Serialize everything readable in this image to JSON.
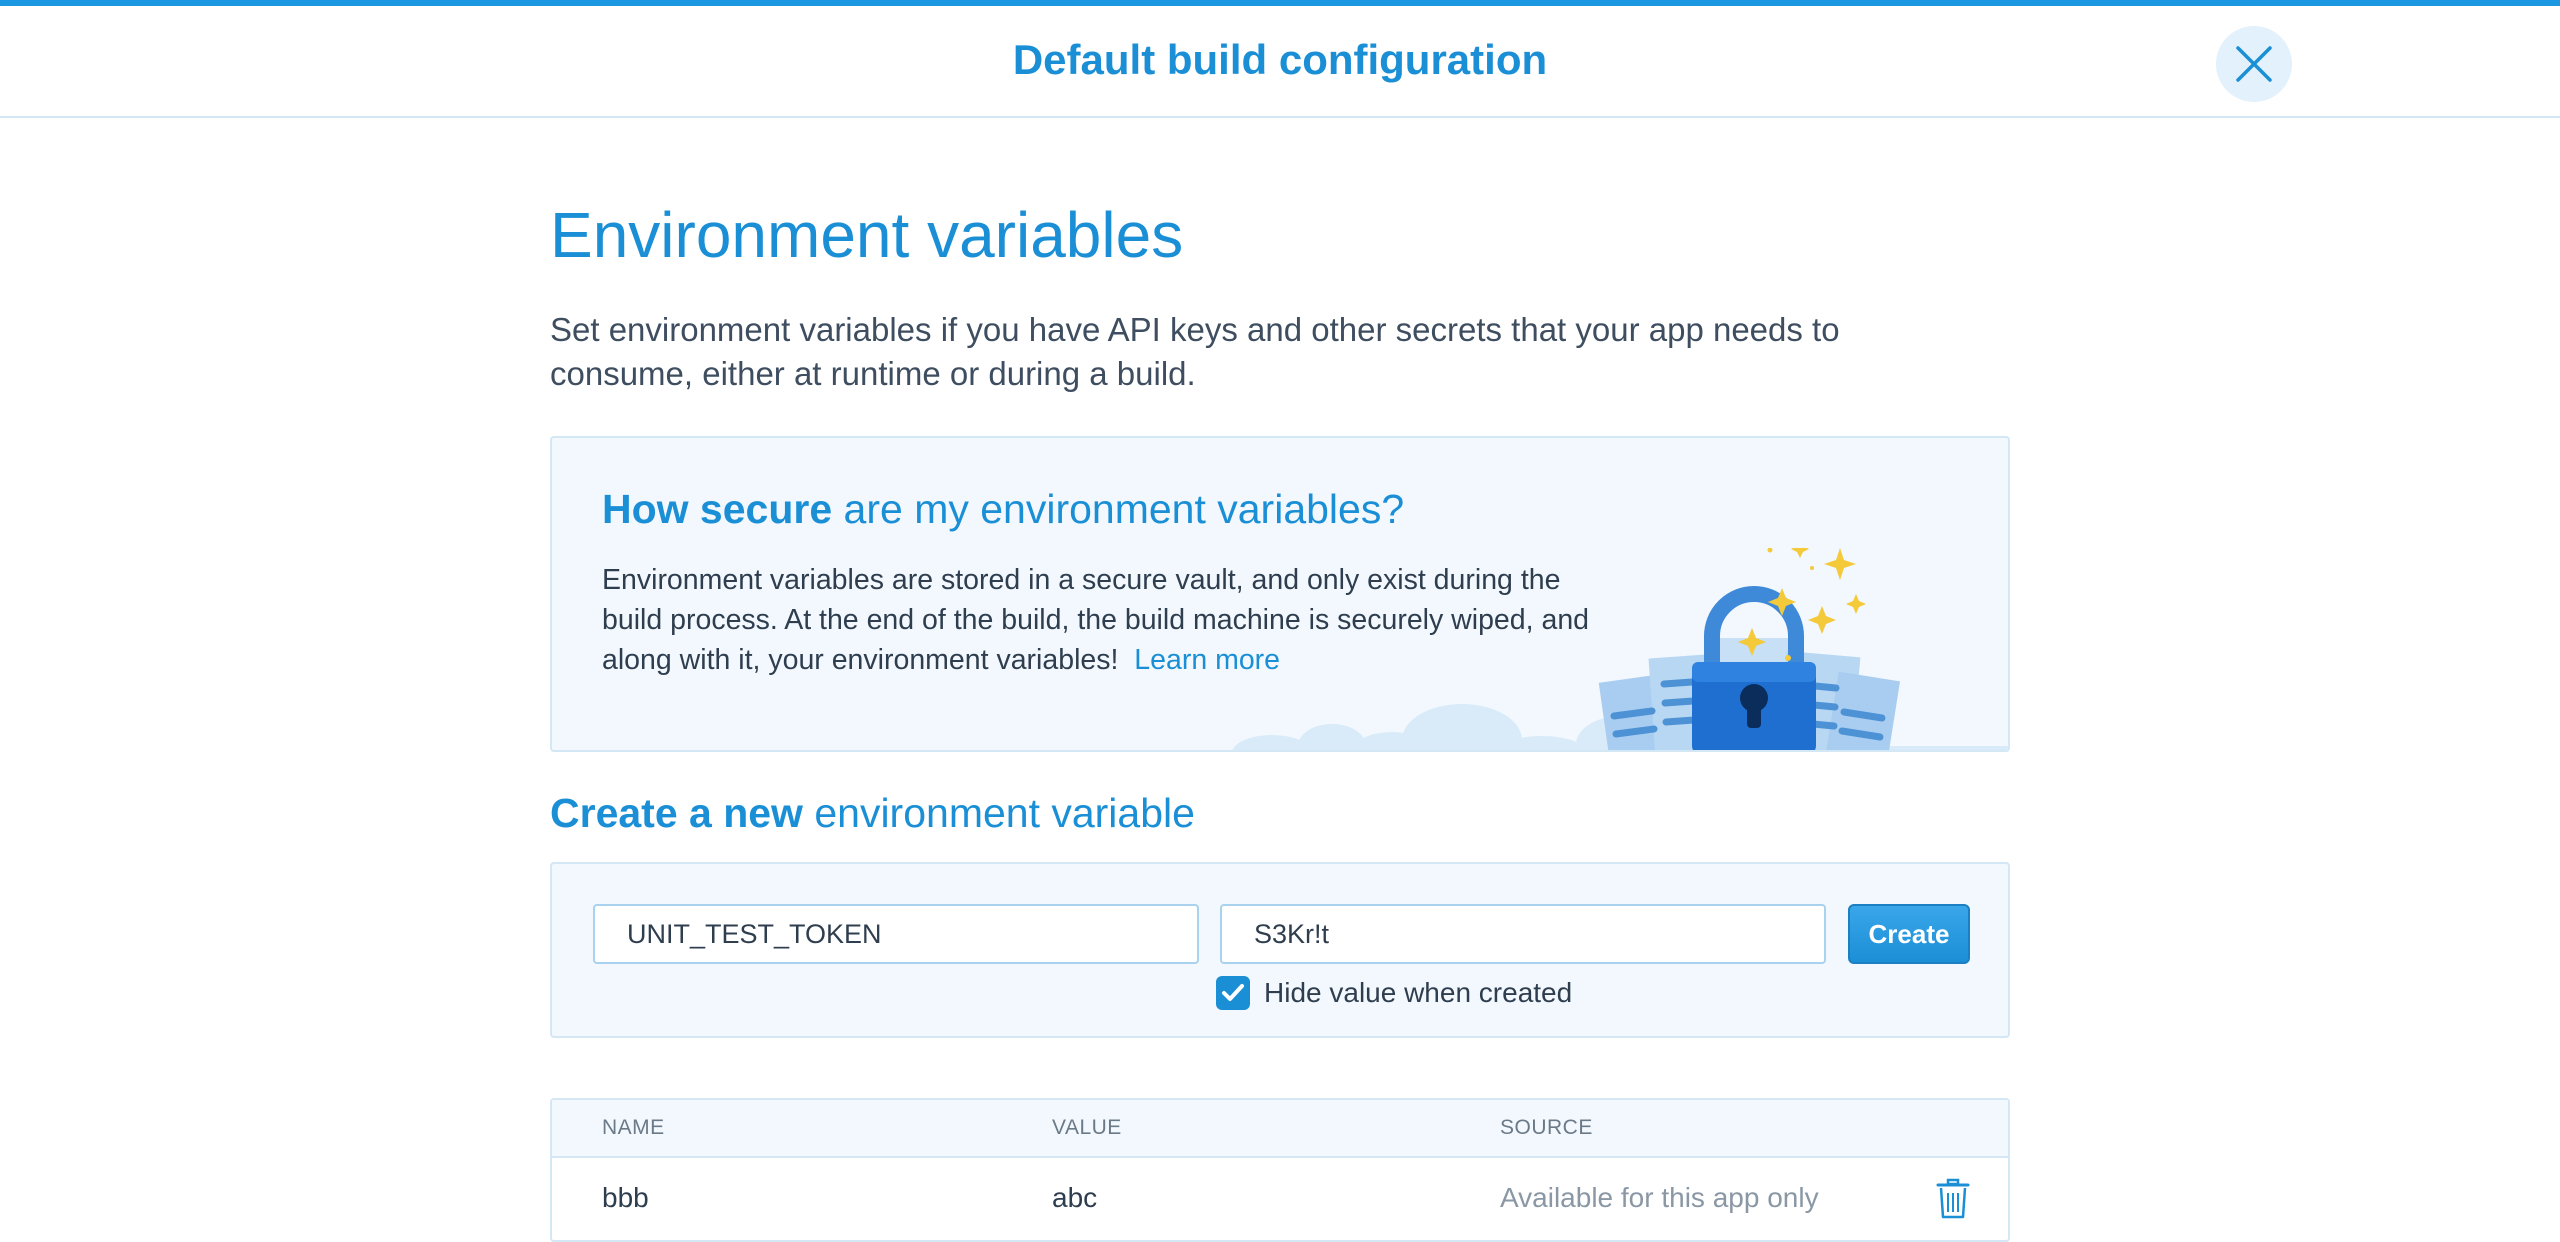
{
  "header": {
    "title": "Default build configuration",
    "close_icon": "close-icon"
  },
  "section": {
    "title": "Environment variables",
    "intro": "Set environment variables if you have API keys and other secrets that your app needs to consume, either at runtime or during a build."
  },
  "info": {
    "heading_bold": "How secure",
    "heading_rest": " are my environment variables?",
    "text": "Environment variables are stored in a secure vault, and only exist during the build process. At the end of the build, the build machine is securely wiped, and along with it, your environment variables!",
    "learn_more": "Learn more",
    "illustration_icon": "lock-illustration"
  },
  "create": {
    "heading_bold": "Create a new",
    "heading_rest": " environment variable",
    "name_value": "UNIT_TEST_TOKEN",
    "value_value": "S3Kr!t",
    "button_label": "Create",
    "hide_label": "Hide value when created",
    "hide_checked": true
  },
  "table": {
    "columns": [
      "NAME",
      "VALUE",
      "SOURCE"
    ],
    "rows": [
      {
        "name": "bbb",
        "value": "abc",
        "source": "Available for this app only",
        "action_icon": "trash-icon"
      }
    ]
  },
  "colors": {
    "accent": "#1b8fd6",
    "panel_bg": "#f2f8fd",
    "panel_border": "#d3e7f5"
  }
}
